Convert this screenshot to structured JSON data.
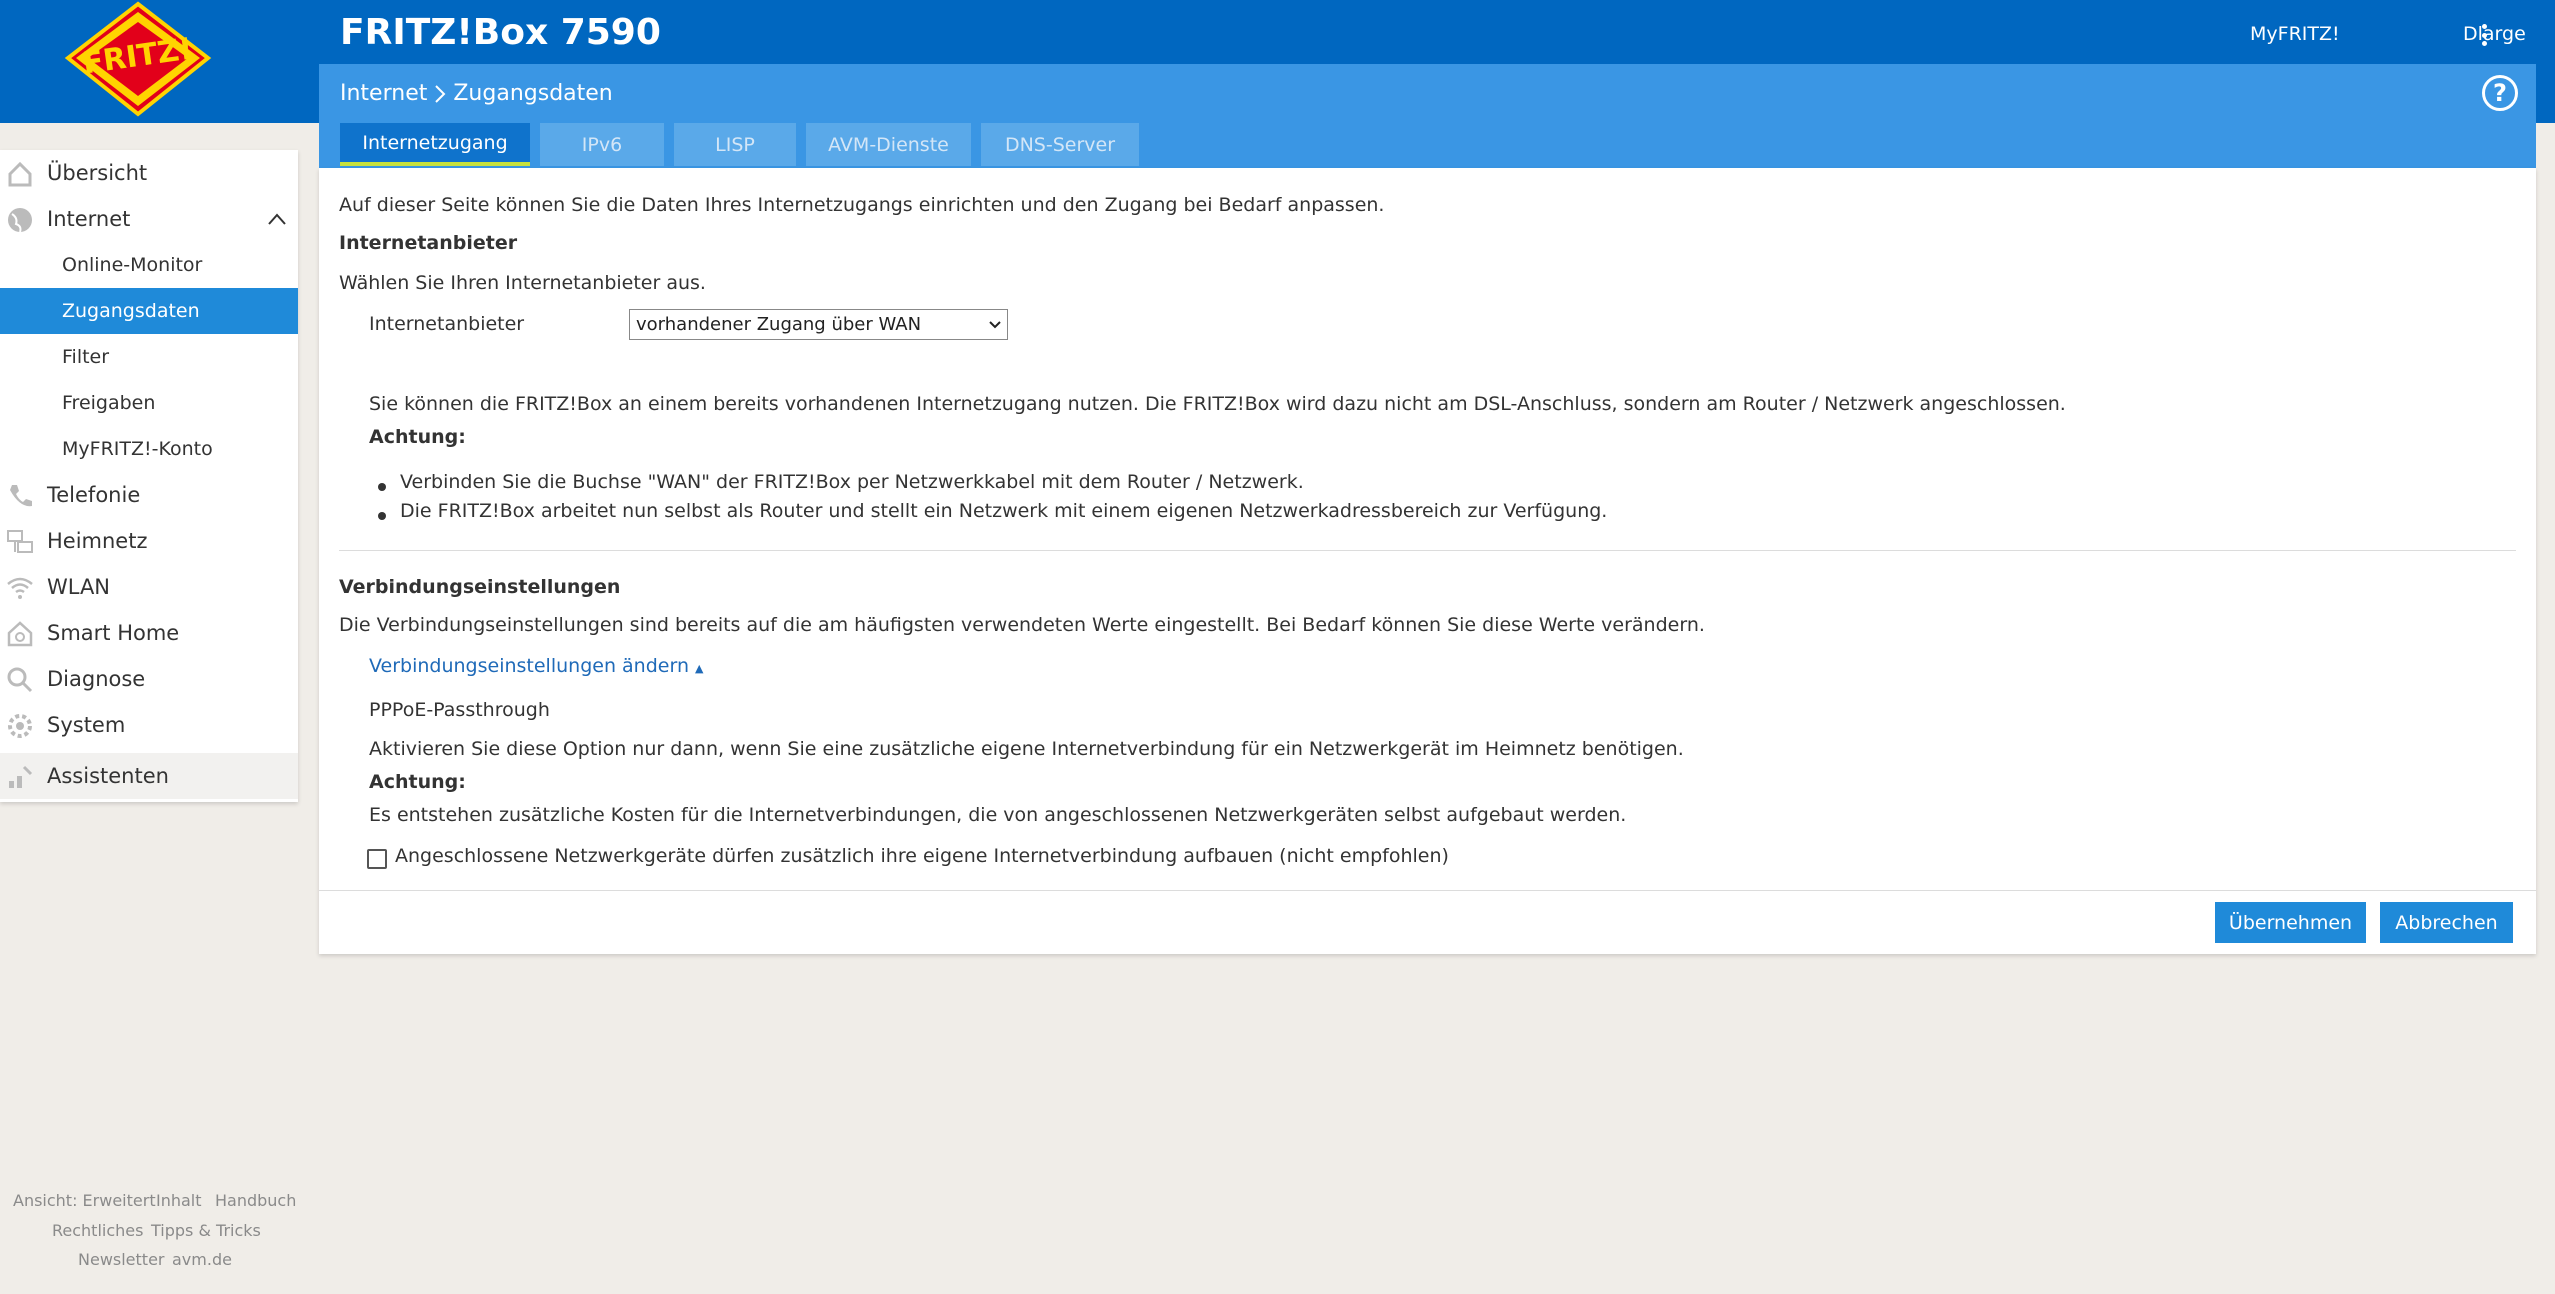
{
  "header": {
    "product_title": "FRITZ!Box 7590",
    "myfritz_label": "MyFRITZ!",
    "user_label": "Dlarge",
    "logo_text": "FRITZ!"
  },
  "breadcrumb": {
    "section": "Internet",
    "page": "Zugangsdaten"
  },
  "tabs": [
    {
      "label": "Internetzugang",
      "active": true
    },
    {
      "label": "IPv6"
    },
    {
      "label": "LISP"
    },
    {
      "label": "AVM-Dienste"
    },
    {
      "label": "DNS-Server"
    }
  ],
  "content": {
    "intro": "Auf dieser Seite können Sie die Daten Ihres Internetzugangs einrichten und den Zugang bei Bedarf anpassen.",
    "provider_heading": "Internetanbieter",
    "provider_hint": "Wählen Sie Ihren Internetanbieter aus.",
    "provider_label": "Internetanbieter",
    "provider_value": "vorhandener Zugang über WAN",
    "wan_info": "Sie können die FRITZ!Box an einem bereits vorhandenen Internetzugang nutzen. Die FRITZ!Box wird dazu nicht am DSL-Anschluss, sondern am Router / Netzwerk angeschlossen.",
    "attention_label": "Achtung:",
    "bullets": [
      "Verbinden Sie die Buchse \"WAN\" der FRITZ!Box per Netzwerkkabel mit dem Router / Netzwerk.",
      "Die FRITZ!Box arbeitet nun selbst als Router und stellt ein Netzwerk mit einem eigenen Netzwerkadressbereich zur Verfügung."
    ],
    "conn_heading": "Verbindungseinstellungen",
    "conn_hint": "Die Verbindungseinstellungen sind bereits auf die am häufigsten verwendeten Werte eingestellt. Bei Bedarf können Sie diese Werte verändern.",
    "conn_link": "Verbindungseinstellungen ändern",
    "pppoe_heading": "PPPoE-Passthrough",
    "pppoe_hint": "Aktivieren Sie diese Option nur dann, wenn Sie eine zusätzliche eigene Internetverbindung für ein Netzwerkgerät im Heimnetz benötigen.",
    "attention_label2": "Achtung:",
    "pppoe_cost": "Es entstehen zusätzliche Kosten für die Internetverbindungen, die von angeschlossenen Netzwerkgeräten selbst aufgebaut werden.",
    "pppoe_checkbox_label": "Angeschlossene Netzwerkgeräte dürfen zusätzlich ihre eigene Internetverbindung aufbauen (nicht empfohlen)",
    "pppoe_checked": false,
    "apply_label": "Übernehmen",
    "cancel_label": "Abbrechen"
  },
  "sidebar": {
    "items": [
      {
        "label": "Übersicht",
        "icon": "home-icon"
      },
      {
        "label": "Internet",
        "icon": "globe-icon",
        "expanded": true
      },
      {
        "label": "Online-Monitor"
      },
      {
        "label": "Zugangsdaten",
        "selected": true
      },
      {
        "label": "Filter"
      },
      {
        "label": "Freigaben"
      },
      {
        "label": "MyFRITZ!-Konto"
      },
      {
        "label": "Telefonie",
        "icon": "phone-icon"
      },
      {
        "label": "Heimnetz",
        "icon": "network-icon"
      },
      {
        "label": "WLAN",
        "icon": "wifi-icon"
      },
      {
        "label": "Smart Home",
        "icon": "smart-home-icon"
      },
      {
        "label": "Diagnose",
        "icon": "diagnosis-icon"
      },
      {
        "label": "System",
        "icon": "system-gear-icon"
      },
      {
        "label": "Assistenten",
        "icon": "wizard-icon"
      }
    ]
  },
  "footer": {
    "view": "Ansicht: Erweitert",
    "contents": "Inhalt",
    "manual": "Handbuch",
    "legal": "Rechtliches",
    "tips": "Tipps & Tricks",
    "newsletter": "Newsletter",
    "website": "avm.de"
  },
  "colors": {
    "header_blue": "#0067c0",
    "subheader_blue": "#3a96e4",
    "accent_blue": "#1f8ad9",
    "tab_underline": "#c6e13e",
    "background": "#f0ede8"
  }
}
